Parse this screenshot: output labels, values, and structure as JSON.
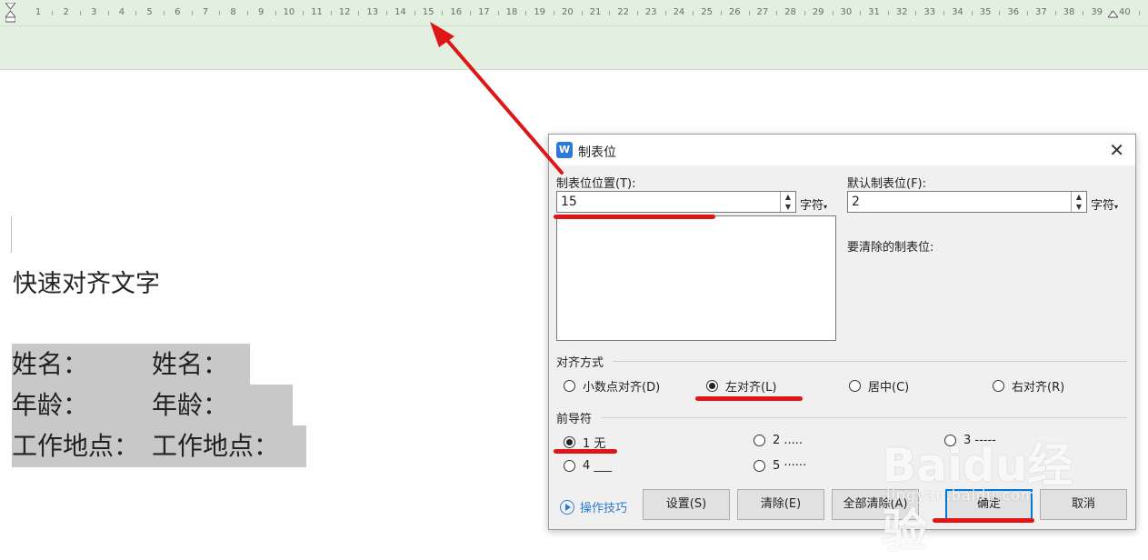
{
  "ruler": {
    "numbers": [
      "1",
      "2",
      "3",
      "4",
      "5",
      "6",
      "7",
      "8",
      "9",
      "10",
      "11",
      "12",
      "13",
      "14",
      "15",
      "16",
      "17",
      "18",
      "19",
      "20",
      "21",
      "22",
      "23",
      "24",
      "25",
      "26",
      "27",
      "28",
      "29",
      "30",
      "31",
      "32",
      "33",
      "34",
      "35",
      "36",
      "37",
      "38",
      "39",
      "40"
    ]
  },
  "document": {
    "heading": "快速对齐文字",
    "lines": [
      {
        "left": "姓名：",
        "right": "姓名："
      },
      {
        "left": "年龄：",
        "right": "年龄："
      },
      {
        "left": "工作地点：",
        "right": "工作地点："
      }
    ]
  },
  "dialog": {
    "title": "制表位",
    "tab_position_label": "制表位位置(T):",
    "tab_position_value": "15",
    "unit_label": "字符",
    "default_tab_label": "默认制表位(F):",
    "default_tab_value": "2",
    "clear_label": "要清除的制表位:",
    "alignment_title": "对齐方式",
    "alignment_options": [
      {
        "label": "小数点对齐(D)",
        "selected": false
      },
      {
        "label": "左对齐(L)",
        "selected": true
      },
      {
        "label": "居中(C)",
        "selected": false
      },
      {
        "label": "右对齐(R)",
        "selected": false
      }
    ],
    "leader_title": "前导符",
    "leader_options": [
      {
        "label": "1 无",
        "selected": true
      },
      {
        "label": "2 .....",
        "selected": false
      },
      {
        "label": "3 -----",
        "selected": false
      },
      {
        "label": "4 ___",
        "selected": false
      },
      {
        "label": "5 ······",
        "selected": false
      }
    ],
    "tips_label": "操作技巧",
    "buttons": {
      "set": "设置(S)",
      "clear": "清除(E)",
      "clear_all": "全部清除(A)",
      "ok": "确定",
      "cancel": "取消"
    }
  },
  "watermark": {
    "logo": "Baidu经验",
    "url": "jingyan.baidu.com"
  },
  "colors": {
    "ruler_bg": "#e3efe1",
    "annotation_red": "#e01616",
    "selection_gray": "#c8c8c8",
    "link_blue": "#2b7bd6"
  }
}
